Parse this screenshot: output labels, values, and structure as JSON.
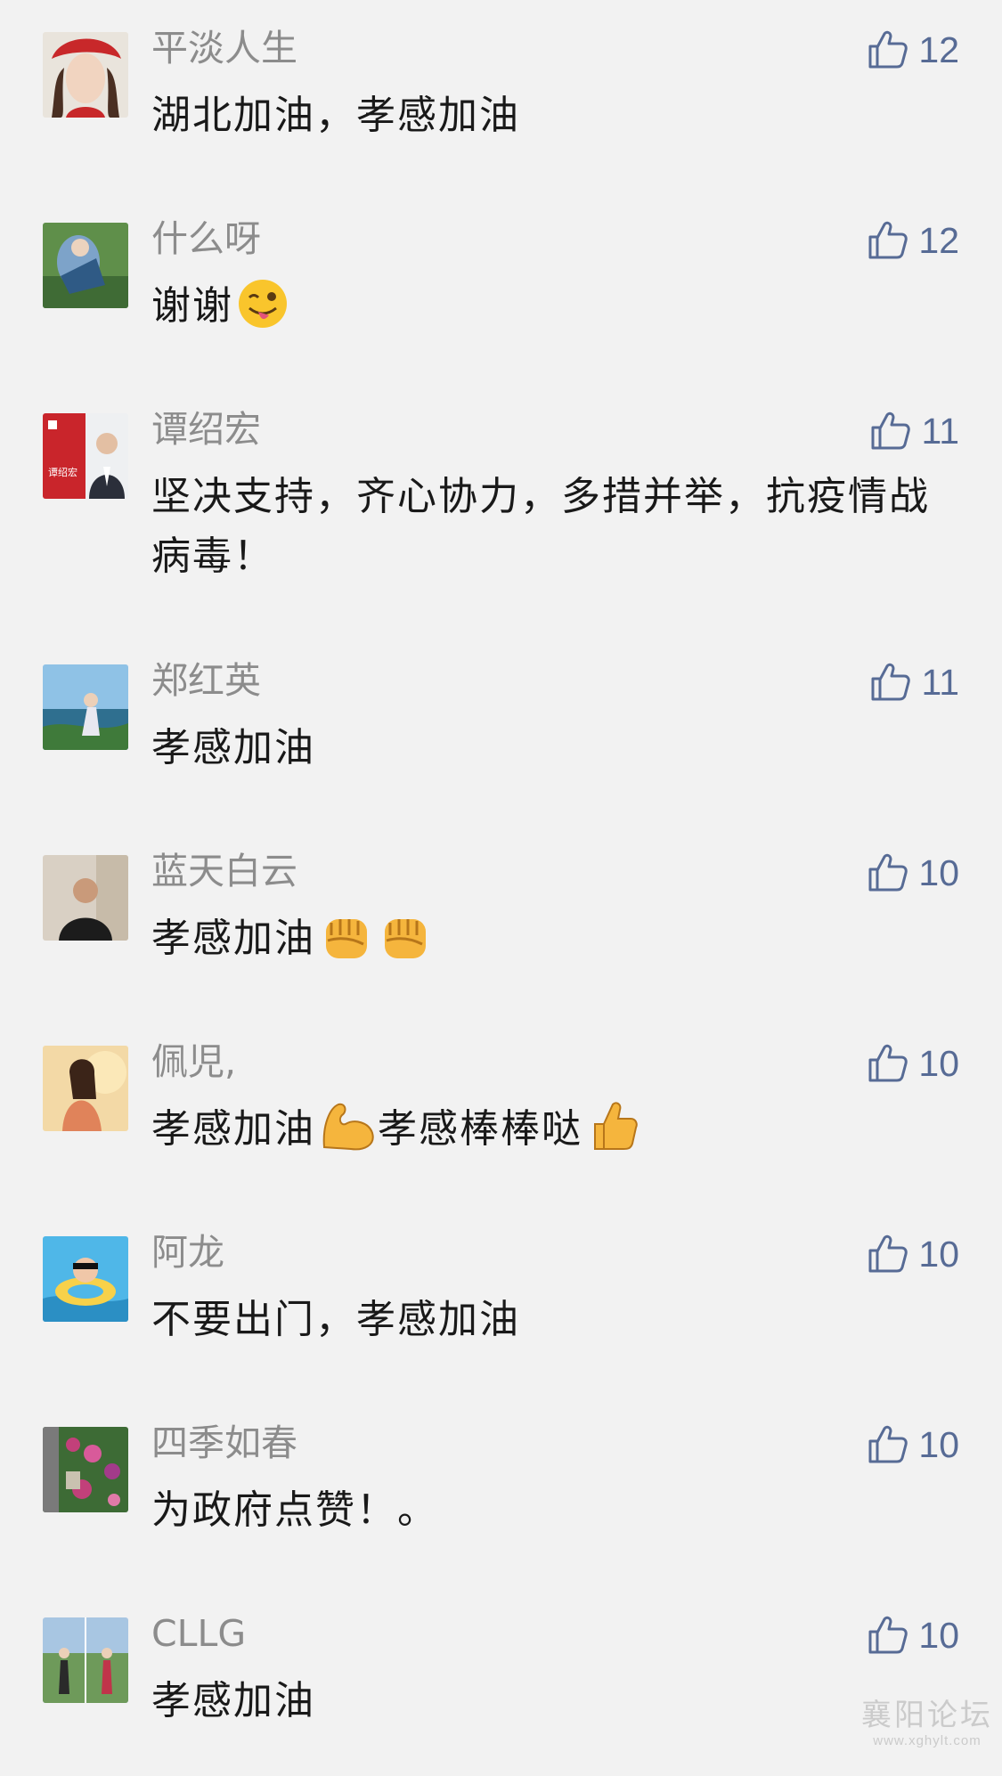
{
  "comments": [
    {
      "user": "平淡人生",
      "text": "湖北加油，孝感加油",
      "likes": "12"
    },
    {
      "user": "什么呀",
      "text": "谢谢",
      "likes": "12",
      "emoji": [
        "winking-tongue-emoji"
      ]
    },
    {
      "user": "谭绍宏",
      "text": "坚决支持，齐心协力，多措并举，抗疫情战病毒！",
      "likes": "11",
      "avatar_card_text": "谭绍宏"
    },
    {
      "user": "郑红英",
      "text": "孝感加油",
      "likes": "11"
    },
    {
      "user": "蓝天白云",
      "text": "孝感加油",
      "likes": "10",
      "emoji": [
        "raised-fist-emoji",
        "raised-fist-emoji"
      ]
    },
    {
      "user": "佩児,",
      "text": "孝感加油",
      "text2": "孝感棒棒哒",
      "likes": "10",
      "emoji": [
        "flexed-biceps-emoji",
        "thumbs-up-emoji"
      ]
    },
    {
      "user": "阿龙",
      "text": "不要出门，孝感加油",
      "likes": "10"
    },
    {
      "user": "四季如春",
      "text": "为政府点赞！。",
      "likes": "10"
    },
    {
      "user": "CLLG",
      "text": "孝感加油",
      "likes": "10"
    }
  ],
  "watermark": {
    "title": "襄阳论坛",
    "url": "www.xghylt.com"
  },
  "colors": {
    "background": "#f2f2f2",
    "username": "#8c8c8c",
    "text": "#191919",
    "like": "#576b95"
  },
  "icons": {
    "like": "thumbs-up-outline-icon"
  }
}
